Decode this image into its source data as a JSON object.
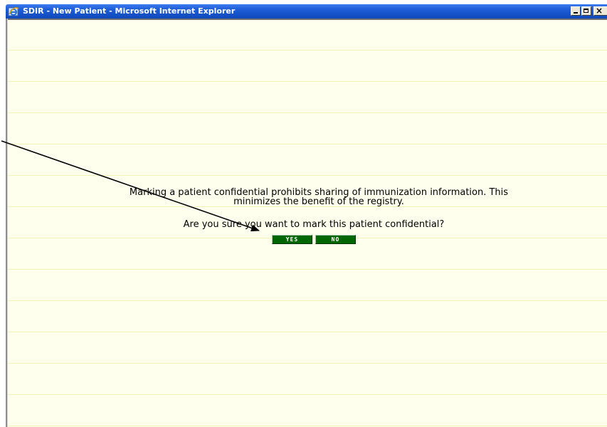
{
  "window": {
    "title": "SDIR - New Patient - Microsoft Internet Explorer",
    "controls": {
      "minimize_icon": "minimize-icon",
      "maximize_icon": "maximize-icon",
      "close_icon": "close-icon",
      "close_glyph": "×"
    }
  },
  "dialog": {
    "message_line1": "Marking a patient confidential prohibits sharing of immunization information. This",
    "message_line2": "minimizes the benefit of the registry.",
    "question": "Are you sure you want to mark this patient confidential?",
    "yes_label": "YES",
    "no_label": "NO"
  },
  "colors": {
    "title_bar": "#1552c8",
    "background": "#ffffee",
    "button": "#006600",
    "button_text": "#ffffff"
  }
}
